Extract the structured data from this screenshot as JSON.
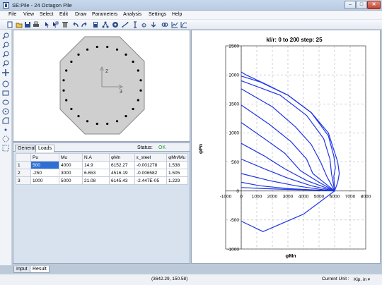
{
  "window": {
    "title": "SE:Pile - 24 Octagon Pile",
    "minimize": "–",
    "maximize": "□",
    "close": "✕"
  },
  "menu": [
    "File",
    "View",
    "Select",
    "Edit",
    "Draw",
    "Parameters",
    "Analysis",
    "Settings",
    "Help"
  ],
  "toolbar_icons": [
    "new-file-icon",
    "open-folder-icon",
    "save-icon",
    "print-icon",
    "pointer-icon",
    "select-icon",
    "delete-icon",
    "undo-icon",
    "redo-icon",
    "calculator-icon",
    "tree-icon",
    "section-icon",
    "line-icon",
    "dimension-icon",
    "phi-icon",
    "arrow-down-icon",
    "link-icon",
    "chart-icon",
    "curve-icon"
  ],
  "side_icons": [
    "zoom-in-icon",
    "zoom-out-icon",
    "zoom-window-icon",
    "zoom-extent-icon",
    "pan-icon",
    "circle-icon",
    "rectangle-icon",
    "ellipse-icon",
    "arc-icon",
    "polygon-icon",
    "point-icon",
    "circle-points-icon",
    "grid-points-icon"
  ],
  "section": {
    "axis_y_label": "2",
    "axis_x_label": "3"
  },
  "loads_panel": {
    "tabs": [
      "General",
      "Loads"
    ],
    "status_label": "Status:",
    "status_value": "OK",
    "columns": [
      "Pu",
      "Mu",
      "N.A",
      "φMn",
      "ε_steel",
      "φMn/Mu"
    ],
    "rows": [
      {
        "num": "1",
        "cells": [
          "500",
          "4000",
          "14.9",
          "6152.27",
          "-0.001278",
          "1.538"
        ]
      },
      {
        "num": "2",
        "cells": [
          "-250",
          "3000",
          "6.653",
          "4516.19",
          "-0.006582",
          "1.505"
        ]
      },
      {
        "num": "3",
        "cells": [
          "1000",
          "5000",
          "21.08",
          "6145.43",
          "-2.447E-05",
          "1.229"
        ]
      }
    ]
  },
  "bottom_tabs": [
    "Input",
    "Result"
  ],
  "status_bar": {
    "coords": "(3642.29, 150.58)",
    "unit_label": "Current Unit :",
    "unit_value": "Kip, in ▾"
  },
  "chart_data": {
    "type": "line",
    "title": "kl/r: 0 to 200 step: 25",
    "xlabel": "φMn",
    "ylabel": "φPn",
    "xlim": [
      -1000,
      8000
    ],
    "ylim": [
      -1000,
      2500
    ],
    "xticks": [
      -1000,
      0,
      1000,
      2000,
      3000,
      4000,
      5000,
      6000,
      7000,
      8000
    ],
    "yticks": [
      -1000,
      -500,
      0,
      500,
      1000,
      1500,
      2000,
      2500
    ],
    "grid": true,
    "line_color": "#1f35e6",
    "series": [
      {
        "x": [
          0,
          300,
          1500,
          3000,
          4500,
          5600,
          5900,
          6200,
          6300,
          6200,
          6000
        ],
        "y": [
          2050,
          2000,
          1850,
          1650,
          1350,
          1000,
          750,
          500,
          300,
          150,
          0
        ]
      },
      {
        "x": [
          0,
          1200,
          3000,
          4500,
          5600,
          5950,
          6050,
          5950,
          6000
        ],
        "y": [
          1980,
          1880,
          1650,
          1350,
          950,
          600,
          400,
          250,
          0
        ]
      },
      {
        "x": [
          0,
          2500,
          4200,
          5300,
          5700,
          5800,
          5900,
          6000
        ],
        "y": [
          1900,
          1650,
          1300,
          900,
          550,
          300,
          150,
          0
        ]
      },
      {
        "x": [
          0,
          2000,
          3500,
          4500,
          5100,
          5500,
          6000
        ],
        "y": [
          1760,
          1450,
          1100,
          800,
          500,
          250,
          0
        ]
      },
      {
        "x": [
          0,
          1800,
          3200,
          4200,
          4600,
          6000
        ],
        "y": [
          1480,
          1150,
          850,
          550,
          300,
          0
        ]
      },
      {
        "x": [
          0,
          1500,
          2800,
          3800,
          5000,
          6000
        ],
        "y": [
          1180,
          900,
          650,
          350,
          150,
          0
        ]
      },
      {
        "x": [
          0,
          1500,
          2800,
          4200,
          6000
        ],
        "y": [
          820,
          600,
          380,
          180,
          0
        ]
      },
      {
        "x": [
          0,
          1500,
          3000,
          4500,
          6000
        ],
        "y": [
          550,
          380,
          220,
          90,
          0
        ]
      },
      {
        "x": [
          0,
          1800,
          3500,
          5000,
          6000
        ],
        "y": [
          300,
          180,
          90,
          30,
          0
        ]
      },
      {
        "x": [
          0,
          1200,
          3000,
          6000
        ],
        "y": [
          150,
          90,
          40,
          0
        ]
      },
      {
        "x": [
          0,
          1500,
          4500,
          6000
        ],
        "y": [
          60,
          40,
          15,
          0
        ]
      },
      {
        "x": [
          0,
          1400,
          4000,
          5500,
          6000
        ],
        "y": [
          -520,
          -700,
          -400,
          -100,
          0
        ]
      }
    ]
  }
}
